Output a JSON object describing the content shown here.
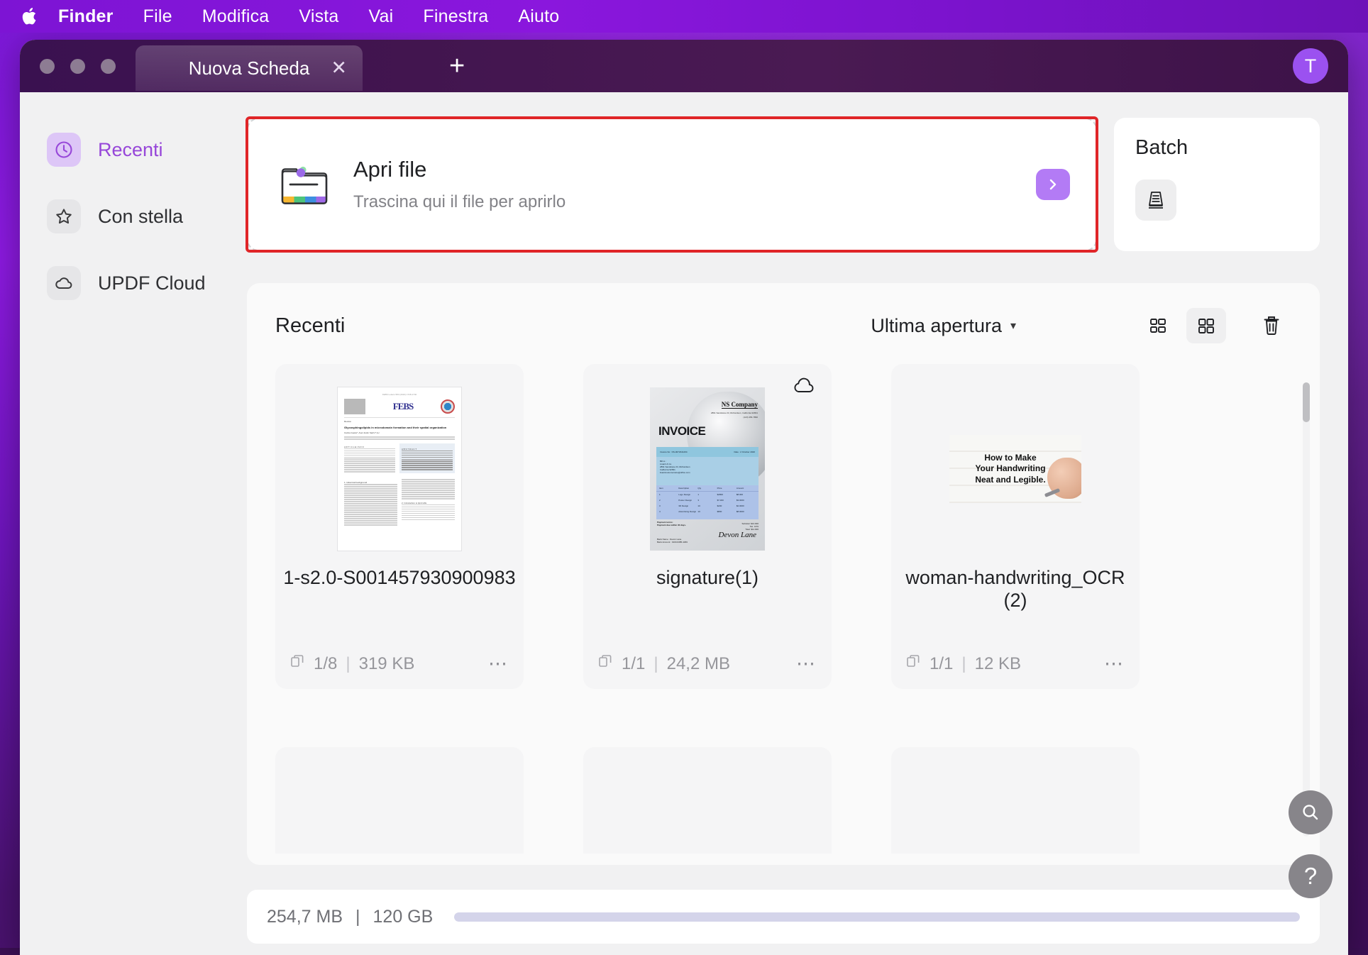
{
  "menubar": {
    "apple_icon": "apple-logo-icon",
    "items": [
      {
        "label": "Finder",
        "bold": true
      },
      {
        "label": "File",
        "bold": false
      },
      {
        "label": "Modifica",
        "bold": false
      },
      {
        "label": "Vista",
        "bold": false
      },
      {
        "label": "Vai",
        "bold": false
      },
      {
        "label": "Finestra",
        "bold": false
      },
      {
        "label": "Aiuto",
        "bold": false
      }
    ]
  },
  "window": {
    "tab": {
      "title": "Nuova Scheda",
      "close_icon": "close-icon",
      "add_icon": "plus-icon"
    },
    "avatar_initial": "T"
  },
  "sidebar": {
    "items": [
      {
        "label": "Recenti",
        "icon": "clock-icon",
        "active": true
      },
      {
        "label": "Con stella",
        "icon": "star-icon",
        "active": false
      },
      {
        "label": "UPDF Cloud",
        "icon": "cloud-icon",
        "active": false
      }
    ]
  },
  "open_file": {
    "title": "Apri file",
    "subtitle": "Trascina qui il file per aprirlo",
    "folder_icon": "folder-icon",
    "arrow_icon": "chevron-right-icon",
    "highlight_color": "#e02528"
  },
  "batch": {
    "title": "Batch",
    "icon": "batch-documents-icon"
  },
  "recents": {
    "title": "Recenti",
    "sort_label": "Ultima apertura",
    "sort_caret": "chevron-down-icon",
    "list_view_icon": "list-view-icon",
    "grid_view_icon": "grid-view-icon",
    "trash_icon": "trash-icon",
    "files": [
      {
        "name": "1-s2.0-S001457930900983",
        "pages": "1/8",
        "size": "319 KB",
        "thumb_type": "paper",
        "cloud": false,
        "more_icon": "more-options-icon",
        "pages_icon": "pages-icon",
        "thumb": {
          "journal": "FEBS",
          "journal_sub": "A JOURNAL FOR BIOLOGICAL SCIENCES",
          "kicker": "Review",
          "title": "Glycosphingolipids in microdomain formation and their spatial organization",
          "authors": "Carina Gupta*, Axel Justin Sarrin*,b,c",
          "info_head": "A R T I C L E  I N F O",
          "abstract_head": "A B S T R A C T",
          "section": "1. Historical background",
          "section2": "2. Introduction to lipid rafts",
          "top_note": "FEBS Letters 584 (2010) 1728-1740"
        }
      },
      {
        "name": "signature(1)",
        "pages": "1/1",
        "size": "24,2 MB",
        "thumb_type": "invoice",
        "cloud": true,
        "cloud_icon": "cloud-icon",
        "more_icon": "more-options-icon",
        "pages_icon": "pages-icon",
        "thumb": {
          "company": "NS Company",
          "company_addr": "2891 Sandstone Dr, Richardson, California 92831",
          "company_phone": "(123) 456-7890",
          "word": "INVOICE",
          "invoice_no": "Invoice No : NS-0072341264",
          "date": "Date : 2 October 2020",
          "bill_to_label": "Bill to :",
          "bill_to": "Lisanti & Co.\n2891 Sandstone Dr, Richardson\nCalifornia 92831\nlisanticustomercare@office.com",
          "columns": [
            "Item",
            "Description",
            "Qty",
            "Price",
            "Amount"
          ],
          "rows": [
            [
              "1",
              "Logo Design",
              "1",
              "$2800",
              "$8.000"
            ],
            [
              "2",
              "Poster Design",
              "3",
              "$7.300",
              "$3.0000"
            ],
            [
              "3",
              "3D Design",
              "10",
              "$200",
              "$2.0000"
            ],
            [
              "4",
              "Advertising Design",
              "10",
              "$800",
              "$8.0000"
            ]
          ],
          "subtotal_label": "Subtotal",
          "subtotal": "$13.000",
          "tax_label": "Tax",
          "tax": "10%",
          "total_label": "Total",
          "total": "$11.000",
          "payment_terms": "Payment terms:\nPayment due within 30 days.",
          "bank_name": "Bank Name :    Devon Lane",
          "bank_account": "Bank Account :   0100-9385-4299",
          "signature_label": "Signature",
          "signature": "Devon Lane"
        }
      },
      {
        "name": "woman-handwriting_OCR (2)",
        "pages": "1/1",
        "size": "12 KB",
        "thumb_type": "handwriting",
        "cloud": false,
        "more_icon": "more-options-icon",
        "pages_icon": "pages-icon",
        "thumb": {
          "line1": "How to Make",
          "line2": "Your Handwriting",
          "line3": "Neat and Legible."
        }
      }
    ]
  },
  "storage": {
    "used": "254,7 MB",
    "separator": "|",
    "total": "120 GB",
    "fill_percent": 100,
    "fill_color": "#d4d4ea"
  },
  "floating": {
    "search_icon": "search-icon",
    "help_icon": "help-icon",
    "help_glyph": "?"
  }
}
